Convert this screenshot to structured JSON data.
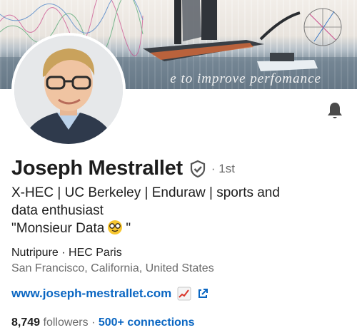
{
  "banner": {
    "tagline": "e  to  improve  perfomance"
  },
  "profile": {
    "name": "Joseph Mestrallet",
    "degree": "· 1st",
    "headline_line1": "X-HEC | UC Berkeley | Enduraw | sports and",
    "headline_line2": "data enthusiast",
    "headline_line3_prefix": "\"Monsieur Data",
    "headline_line3_suffix": "\"",
    "company_school": "Nutripure · HEC Paris",
    "location": "San Francisco, California, United States",
    "website": "www.joseph-mestrallet.com",
    "followers_count": "8,749",
    "followers_label": "followers ·",
    "connections": "500+ connections"
  },
  "icons": {
    "notification": "bell-icon",
    "verified": "shield-check-icon",
    "nerd": "nerd-face-emoji",
    "chart": "chart-increasing-emoji",
    "external": "external-link-icon"
  },
  "colors": {
    "link": "#0a66c2",
    "muted": "#6b6b6b",
    "text": "#1d1d1d"
  }
}
